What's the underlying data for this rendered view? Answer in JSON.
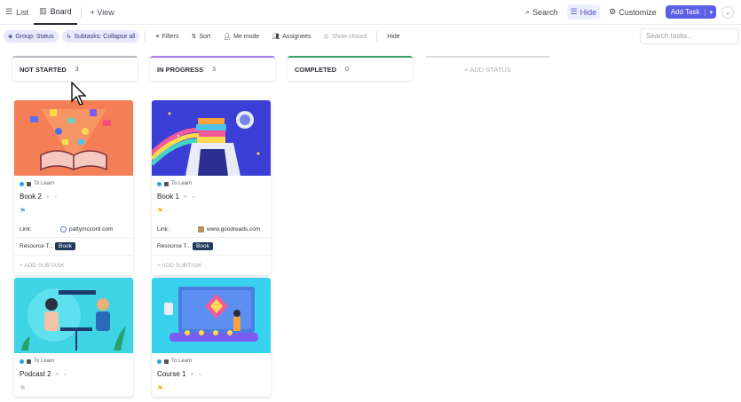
{
  "tabs": [
    {
      "label": "List",
      "icon": "list-icon"
    },
    {
      "label": "Board",
      "icon": "board-icon"
    },
    {
      "label": "+ View",
      "icon": "plus-icon"
    }
  ],
  "toolbar": {
    "search_label": "Search",
    "hide_label": "Hide",
    "customize_label": "Customize",
    "add_task_label": "Add Task"
  },
  "filters": {
    "group_label": "Group: Status",
    "subtasks_label": "Subtasks: Collapse all",
    "filters_label": "Filters",
    "sort_label": "Sort",
    "me_mode_label": "Me mode",
    "assignees_label": "Assignees",
    "show_closed_label": "Show closed",
    "hide_label": "Hide",
    "search_placeholder": "Search tasks..."
  },
  "columns": [
    {
      "name": "NOT STARTED",
      "count": "3",
      "color": "#b9bcc2"
    },
    {
      "name": "IN PROGRESS",
      "count": "3",
      "color": "#a97ce8"
    },
    {
      "name": "COMPLETED",
      "count": "0",
      "color": "#37a26d"
    }
  ],
  "add_status_label": "+ ADD STATUS",
  "cards": [
    {
      "list": "To Learn",
      "title": "Book 2",
      "link_label": "Link:",
      "link": "pattymccord.com",
      "resource_label": "Resource T...",
      "resource": "Book",
      "add_subtask": "+ ADD SUBTASK"
    },
    {
      "list": "To Learn",
      "title": "Book 1",
      "link_label": "Link:",
      "link": "www.goodreads.com",
      "resource_label": "Resource T...",
      "resource": "Book",
      "add_subtask": "+ ADD SUBTASK"
    },
    {
      "list": "To Learn",
      "title": "Podcast 2"
    },
    {
      "list": "To Learn",
      "title": "Course 1"
    }
  ]
}
